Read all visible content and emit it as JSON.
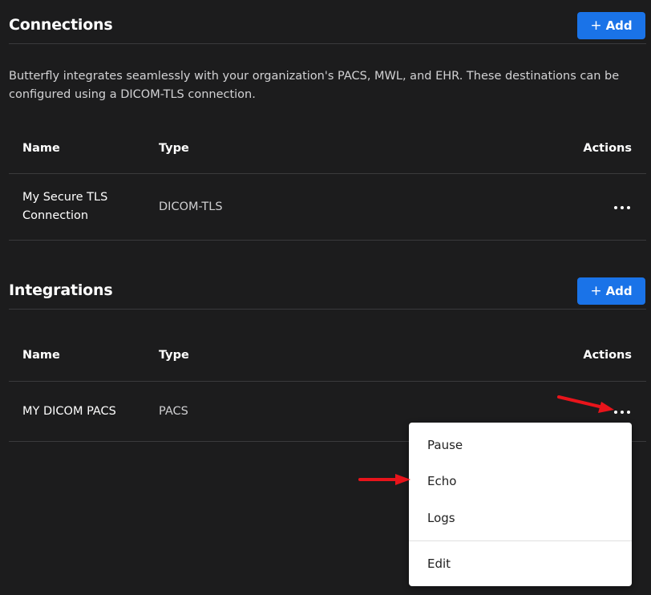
{
  "connections": {
    "title": "Connections",
    "add_label": "Add",
    "description": "Butterfly integrates seamlessly with your organization's PACS, MWL, and EHR. These destinations can be configured using a DICOM-TLS connection.",
    "columns": {
      "name": "Name",
      "type": "Type",
      "actions": "Actions"
    },
    "rows": [
      {
        "name": "My Secure TLS Connection",
        "type": "DICOM-TLS"
      }
    ]
  },
  "integrations": {
    "title": "Integrations",
    "add_label": "Add",
    "columns": {
      "name": "Name",
      "type": "Type",
      "actions": "Actions"
    },
    "rows": [
      {
        "name": "MY DICOM PACS",
        "type": "PACS"
      }
    ]
  },
  "action_menu": {
    "items": [
      "Pause",
      "Echo",
      "Logs",
      "Edit"
    ]
  },
  "icons": {
    "add": "plus-icon",
    "row_actions": "more-horizontal-icon",
    "annotation": "red-arrow-icon"
  },
  "colors": {
    "background": "#1c1c1d",
    "accent": "#1a73e8",
    "annotation": "#e8141b",
    "menu_background": "#ffffff"
  }
}
